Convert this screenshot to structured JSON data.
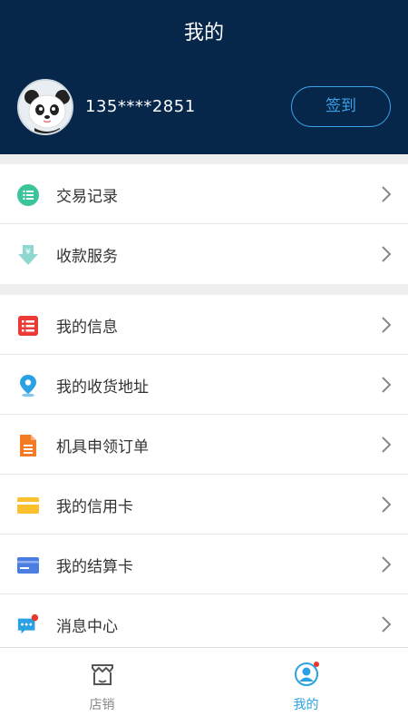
{
  "header": {
    "title": "我的"
  },
  "profile": {
    "phone": "135****2851",
    "signin_label": "签到"
  },
  "menu_group_1": [
    {
      "label": "交易记录",
      "icon": "transaction-record-icon"
    },
    {
      "label": "收款服务",
      "icon": "payment-service-icon"
    }
  ],
  "menu_group_2": [
    {
      "label": "我的信息",
      "icon": "my-info-icon"
    },
    {
      "label": "我的收货地址",
      "icon": "location-pin-icon"
    },
    {
      "label": "机具申领订单",
      "icon": "document-icon"
    },
    {
      "label": "我的信用卡",
      "icon": "credit-card-icon"
    },
    {
      "label": "我的结算卡",
      "icon": "settlement-card-icon"
    },
    {
      "label": "消息中心",
      "icon": "message-icon"
    }
  ],
  "bottom_nav": {
    "tabs": [
      {
        "label": "店销",
        "icon": "store-icon",
        "active": false
      },
      {
        "label": "我的",
        "icon": "user-icon",
        "active": true
      }
    ]
  },
  "colors": {
    "header_bg": "#06264a",
    "accent": "#2aa1e3",
    "badge": "#e8382d"
  }
}
